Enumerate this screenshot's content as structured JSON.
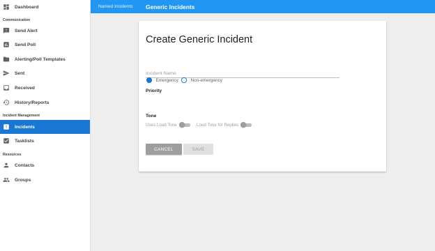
{
  "sidebar": {
    "sections": {
      "communication": "Communication",
      "incident_management": "Incident Management",
      "resources": "Resources"
    },
    "items": [
      {
        "label": "Dashboard",
        "icon": "dashboard-icon"
      },
      {
        "label": "Send Alert",
        "icon": "alert-message-icon"
      },
      {
        "label": "Send Poll",
        "icon": "poll-chart-icon"
      },
      {
        "label": "Alerting/Poll Templates",
        "icon": "folder-icon"
      },
      {
        "label": "Sent",
        "icon": "send-icon"
      },
      {
        "label": "Received",
        "icon": "inbox-icon"
      },
      {
        "label": "History/Reports",
        "icon": "history-icon"
      },
      {
        "label": "Incidents",
        "icon": "incident-icon",
        "active": true
      },
      {
        "label": "Tasklists",
        "icon": "checkbox-icon"
      },
      {
        "label": "Contacts",
        "icon": "person-icon"
      },
      {
        "label": "Groups",
        "icon": "group-icon"
      }
    ]
  },
  "topbar": {
    "breadcrumb_link": "Named Incidents",
    "title": "Generic Incidents"
  },
  "form": {
    "title": "Create Generic Incident",
    "incident_name": {
      "placeholder": "Incident Name",
      "value": ""
    },
    "priority": {
      "label": "Priority",
      "options": [
        "Emergency",
        "Non-emergency"
      ],
      "selected": "Emergency"
    },
    "tone": {
      "label": "Tone",
      "toggles": [
        {
          "label": "Uses Loud Tone",
          "on": false
        },
        {
          "label": "Loud Tone for Replies",
          "on": false
        }
      ]
    },
    "buttons": {
      "cancel": "CANCEL",
      "save": "SAVE"
    }
  },
  "colors": {
    "accent": "#2196f3",
    "active_nav": "#1976d2",
    "background": "#eeeeee"
  }
}
